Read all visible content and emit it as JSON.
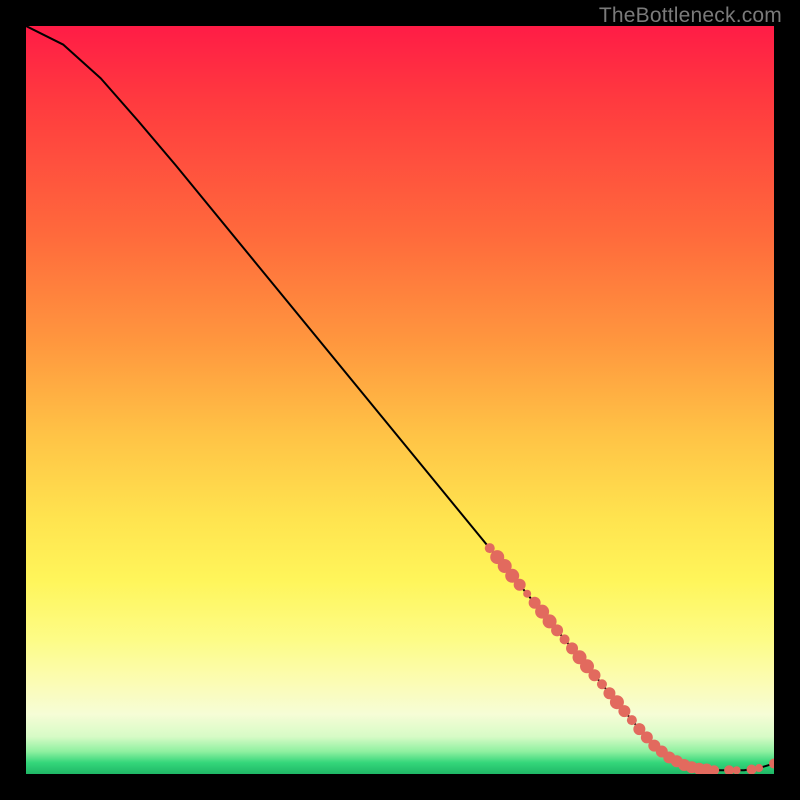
{
  "watermark": "TheBottleneck.com",
  "chart_data": {
    "type": "line",
    "title": "",
    "xlabel": "",
    "ylabel": "",
    "xlim": [
      0,
      100
    ],
    "ylim": [
      0,
      100
    ],
    "grid": false,
    "legend": false,
    "series": [
      {
        "name": "curve",
        "x": [
          0,
          5,
          10,
          15,
          20,
          25,
          30,
          35,
          40,
          45,
          50,
          55,
          60,
          65,
          70,
          75,
          80,
          82,
          84,
          86,
          88,
          90,
          92,
          94,
          96,
          98,
          100
        ],
        "y": [
          100,
          97.5,
          93,
          87.3,
          81.4,
          75.3,
          69.2,
          63.1,
          57,
          50.9,
          44.8,
          38.7,
          32.6,
          26.5,
          20.4,
          14.4,
          8.4,
          6,
          3.8,
          2.2,
          1.2,
          0.7,
          0.5,
          0.5,
          0.5,
          0.8,
          1.4
        ]
      }
    ],
    "markers": {
      "name": "highlight-dots",
      "color": "#e26a5e",
      "points": [
        {
          "x": 62,
          "y": 30.2,
          "r": 5
        },
        {
          "x": 63,
          "y": 29.0,
          "r": 7
        },
        {
          "x": 64,
          "y": 27.8,
          "r": 7
        },
        {
          "x": 65,
          "y": 26.5,
          "r": 7
        },
        {
          "x": 66,
          "y": 25.3,
          "r": 6
        },
        {
          "x": 67,
          "y": 24.1,
          "r": 4
        },
        {
          "x": 68,
          "y": 22.9,
          "r": 6
        },
        {
          "x": 69,
          "y": 21.7,
          "r": 7
        },
        {
          "x": 70,
          "y": 20.4,
          "r": 7
        },
        {
          "x": 71,
          "y": 19.2,
          "r": 6
        },
        {
          "x": 72,
          "y": 18.0,
          "r": 5
        },
        {
          "x": 73,
          "y": 16.8,
          "r": 6
        },
        {
          "x": 74,
          "y": 15.6,
          "r": 7
        },
        {
          "x": 75,
          "y": 14.4,
          "r": 7
        },
        {
          "x": 76,
          "y": 13.2,
          "r": 6
        },
        {
          "x": 77,
          "y": 12.0,
          "r": 5
        },
        {
          "x": 78,
          "y": 10.8,
          "r": 6
        },
        {
          "x": 79,
          "y": 9.6,
          "r": 7
        },
        {
          "x": 80,
          "y": 8.4,
          "r": 6
        },
        {
          "x": 81,
          "y": 7.2,
          "r": 5
        },
        {
          "x": 82,
          "y": 6.0,
          "r": 6
        },
        {
          "x": 83,
          "y": 4.9,
          "r": 6
        },
        {
          "x": 84,
          "y": 3.8,
          "r": 6
        },
        {
          "x": 85,
          "y": 3.0,
          "r": 6
        },
        {
          "x": 86,
          "y": 2.2,
          "r": 6
        },
        {
          "x": 87,
          "y": 1.7,
          "r": 6
        },
        {
          "x": 88,
          "y": 1.2,
          "r": 6
        },
        {
          "x": 89,
          "y": 0.9,
          "r": 6
        },
        {
          "x": 90,
          "y": 0.7,
          "r": 6
        },
        {
          "x": 91,
          "y": 0.6,
          "r": 6
        },
        {
          "x": 92,
          "y": 0.5,
          "r": 5
        },
        {
          "x": 94,
          "y": 0.5,
          "r": 5
        },
        {
          "x": 95,
          "y": 0.5,
          "r": 4
        },
        {
          "x": 97,
          "y": 0.6,
          "r": 5
        },
        {
          "x": 98,
          "y": 0.8,
          "r": 4
        },
        {
          "x": 100,
          "y": 1.4,
          "r": 5
        }
      ]
    }
  }
}
